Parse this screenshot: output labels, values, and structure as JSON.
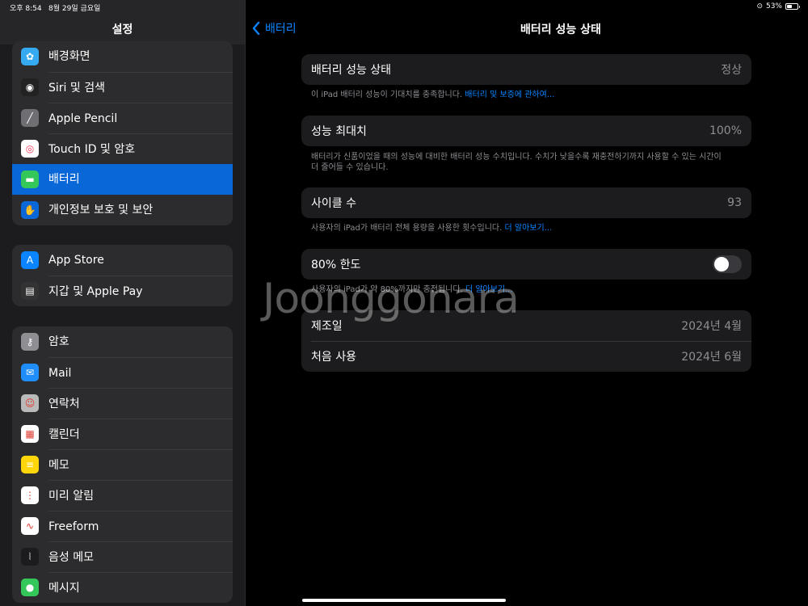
{
  "status_bar": {
    "time": "오후 8:54",
    "date": "8월 29일 금요일",
    "battery_pct": "53%",
    "battery_level": 0.53
  },
  "sidebar": {
    "title": "설정",
    "group1": [
      {
        "label": "배경화면",
        "icon": "wallpaper-icon",
        "color": "#35aaf0"
      },
      {
        "label": "Siri 및 검색",
        "icon": "siri-icon",
        "color": "#222"
      },
      {
        "label": "Apple Pencil",
        "icon": "pencil-icon",
        "color": "#6e6e73"
      },
      {
        "label": "Touch ID 및 암호",
        "icon": "fingerprint-icon",
        "color": "#ffffff"
      },
      {
        "label": "배터리",
        "icon": "battery-icon",
        "color": "#34c759",
        "selected": true
      },
      {
        "label": "개인정보 보호 및 보안",
        "icon": "hand-icon",
        "color": "#0a67d8"
      }
    ],
    "group2": [
      {
        "label": "App Store",
        "icon": "appstore-icon",
        "color": "#0a84ff"
      },
      {
        "label": "지갑 및 Apple Pay",
        "icon": "wallet-icon",
        "color": "#333"
      }
    ],
    "group3": [
      {
        "label": "암호",
        "icon": "key-icon",
        "color": "#8e8e93"
      },
      {
        "label": "Mail",
        "icon": "mail-icon",
        "color": "#1f8efa"
      },
      {
        "label": "연락처",
        "icon": "contacts-icon",
        "color": "#b9b9b9"
      },
      {
        "label": "캘린더",
        "icon": "calendar-icon",
        "color": "#ffffff"
      },
      {
        "label": "메모",
        "icon": "notes-icon",
        "color": "#ffd60a"
      },
      {
        "label": "미리 알림",
        "icon": "reminders-icon",
        "color": "#ffffff"
      },
      {
        "label": "Freeform",
        "icon": "freeform-icon",
        "color": "#ffffff"
      },
      {
        "label": "음성 메모",
        "icon": "voice-memo-icon",
        "color": "#1c1c1e"
      },
      {
        "label": "메시지",
        "icon": "messages-icon",
        "color": "#34c759"
      }
    ]
  },
  "main": {
    "back_label": "배터리",
    "title": "배터리 성능 상태",
    "health": {
      "label": "배터리 성능 상태",
      "value": "정상",
      "note": "이 iPad 배터리 성능이 기대치를 충족합니다.",
      "link": "배터리 및 보증에 관하여..."
    },
    "max_capacity": {
      "label": "성능 최대치",
      "value": "100%",
      "note1": "배터리가 신품이었을 때의 성능에 대비한 배터리 성능 수치입니다. 수치가 낮을수록 재충전하기까지 사용할 수 있는 시간이",
      "note2": "더 줄어들 수 있습니다."
    },
    "cycle": {
      "label": "사이클 수",
      "value": "93",
      "note": "사용자의 iPad가 배터리 전체 용량을 사용한 횟수입니다.",
      "link": "더 알아보기..."
    },
    "limit": {
      "label": "80% 한도",
      "on": false,
      "note": "사용자의 iPad가 약 80%까지만 충전됩니다.",
      "link": "더 알아보기..."
    },
    "manufactured": {
      "label": "제조일",
      "value": "2024년 4월"
    },
    "first_use": {
      "label": "처음 사용",
      "value": "2024년 6월"
    }
  },
  "watermark": "Joonggonara"
}
